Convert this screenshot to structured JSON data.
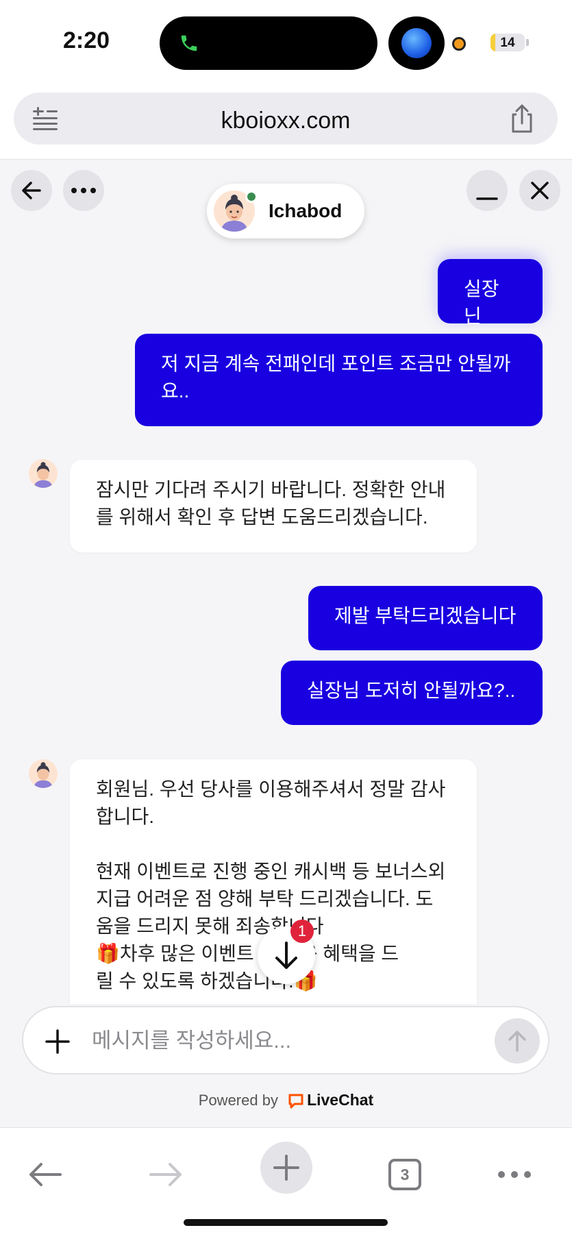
{
  "status_bar": {
    "time": "2:20",
    "battery_level": "14",
    "battery_fraction": 0.14
  },
  "browser": {
    "url": "kboioxx.com",
    "tabs_count": "3"
  },
  "chat": {
    "agent_name": "Ichabod",
    "messages": [
      {
        "side": "out",
        "text": "실장닌"
      },
      {
        "side": "out",
        "text": "저 지금 계속 전패인데 포인트 조금만 안될까\n요.."
      },
      {
        "side": "in",
        "text": "잠시만 기다려 주시기 바랍니다. 정확한 안내\n를 위해서 확인 후 답변 도움드리겠습니다."
      },
      {
        "side": "out",
        "text": "제발 부탁드리겠습니다"
      },
      {
        "side": "out",
        "text": "실장님 도저히 안될까요?.."
      },
      {
        "side": "in",
        "text": "회원님. 우선 당사를 이용해주셔서 정말 감사\n합니다.\n\n현재 이벤트로 진행 중인 캐시백 등 보너스외\n지급 어려운 점 양해 부탁 드리겠습니다. 도\n움을 드리지 못해 죄송합니다\n🎁차후 많은 이벤트 및 이용 혜택을 드\n릴 수 있도록 하겠습니다.🎁"
      }
    ],
    "unread_badge": "1",
    "composer_placeholder": "메시지를 작성하세요...",
    "powered_by": "Powered by",
    "brand": "LiveChat"
  },
  "colors": {
    "outgoing_bubble": "#1900e0",
    "accent_brand": "#ff5100",
    "online": "#3a8d4f"
  }
}
